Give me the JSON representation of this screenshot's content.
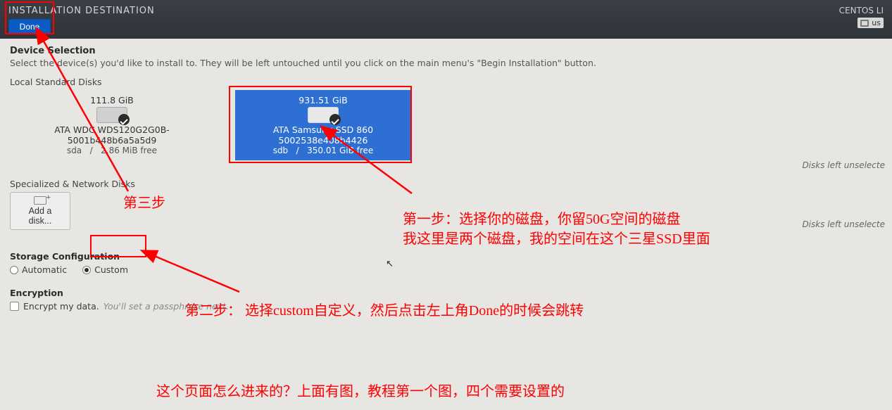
{
  "header": {
    "title": "INSTALLATION DESTINATION",
    "done_label": "Done",
    "distro": "CENTOS LI",
    "lang": "us"
  },
  "device_selection": {
    "title": "Device Selection",
    "subtitle": "Select the device(s) you'd like to install to.  They will be left untouched until you click on the main menu's \"Begin Installation\" button."
  },
  "local_disks": {
    "heading": "Local Standard Disks",
    "right_note": "Disks left unselecte",
    "disks": [
      {
        "size": "111.8 GiB",
        "label": "ATA WDC WDS120G2G0B- 5001b448b6a5a5d9",
        "dev": "sda",
        "sep": "/",
        "free": "2.86 MiB free",
        "selected": false
      },
      {
        "size": "931.51 GiB",
        "label": "ATA Samsung SSD 860 5002538e408b4426",
        "dev": "sdb",
        "sep": "/",
        "free": "350.01 GiB free",
        "selected": true
      }
    ]
  },
  "network_disks": {
    "heading": "Specialized & Network Disks",
    "add_label": "Add a disk...",
    "right_note": "Disks left unselecte"
  },
  "storage_config": {
    "heading": "Storage Configuration",
    "automatic_label": "Automatic",
    "custom_label": "Custom",
    "selected": "custom"
  },
  "encryption": {
    "heading": "Encryption",
    "checkbox_label": "Encrypt my data.",
    "hint": "You'll set a passphrase next."
  },
  "annotations": {
    "step1a": "第一步：选择你的磁盘，你留50G空间的磁盘",
    "step1b": "我这里是两个磁盘，我的空间在这个三星SSD里面",
    "step2": "第二步：  选择custom自定义，然后点击左上角Done的时候会跳转",
    "step3": "第三步",
    "footer": "这个页面怎么进来的？上面有图，教程第一个图，四个需要设置的"
  }
}
